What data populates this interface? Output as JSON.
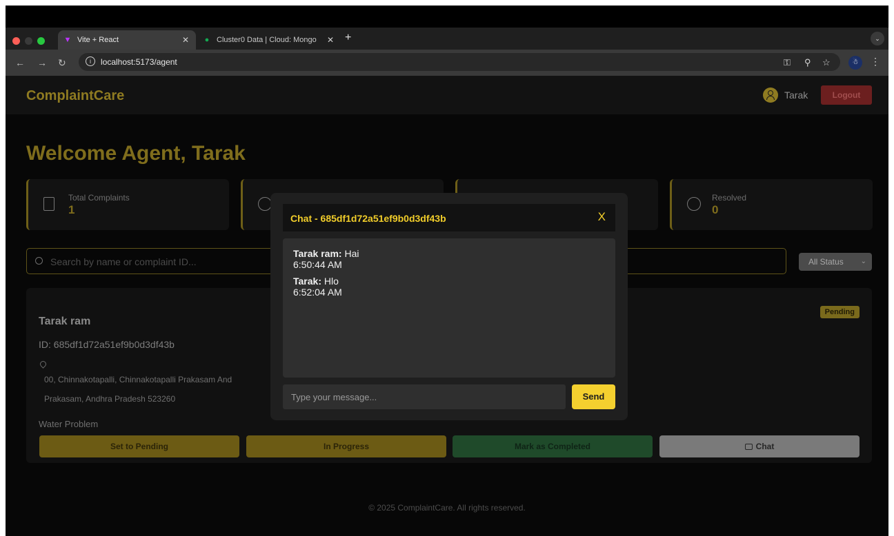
{
  "browser": {
    "tabs": [
      {
        "label": "Vite + React",
        "active": true
      },
      {
        "label": "Cluster0 Data | Cloud: Mongo",
        "active": false
      }
    ],
    "url": "localhost:5173/agent"
  },
  "header": {
    "brand": "ComplaintCare",
    "user_name": "Tarak",
    "logout_label": "Logout"
  },
  "welcome": "Welcome Agent, Tarak",
  "stats": [
    {
      "label": "Total Complaints",
      "value": "1"
    },
    {
      "label": "Resolved",
      "value": "0"
    }
  ],
  "search": {
    "placeholder": "Search by name or complaint ID..."
  },
  "status_filter": {
    "selected": "All Status"
  },
  "complaint": {
    "name": "Tarak ram",
    "id_text": "ID: 685df1d72a51ef9b0d3df43b",
    "address_line1": "00, Chinnakotapalli, Chinnakotapalli Prakasam And",
    "address_line2": "Prakasam, Andhra Pradesh 523260",
    "issue": "Water Problem",
    "status": "Pending",
    "actions": {
      "pending": "Set to Pending",
      "progress": "In Progress",
      "complete": "Mark as Completed",
      "chat": "Chat"
    }
  },
  "footer": "© 2025 ComplaintCare. All rights reserved.",
  "chat_modal": {
    "title": "Chat - 685df1d72a51ef9b0d3df43b",
    "close_label": "X",
    "messages": [
      {
        "sender": "Tarak ram:",
        "text": " Hai",
        "time": "6:50:44 AM"
      },
      {
        "sender": "Tarak:",
        "text": " Hlo",
        "time": "6:52:04 AM"
      }
    ],
    "input_placeholder": "Type your message...",
    "send_label": "Send"
  },
  "colors": {
    "accent": "#f1cd2a",
    "brand_dim": "#8f7b21",
    "logout": "#6c1f1f"
  }
}
